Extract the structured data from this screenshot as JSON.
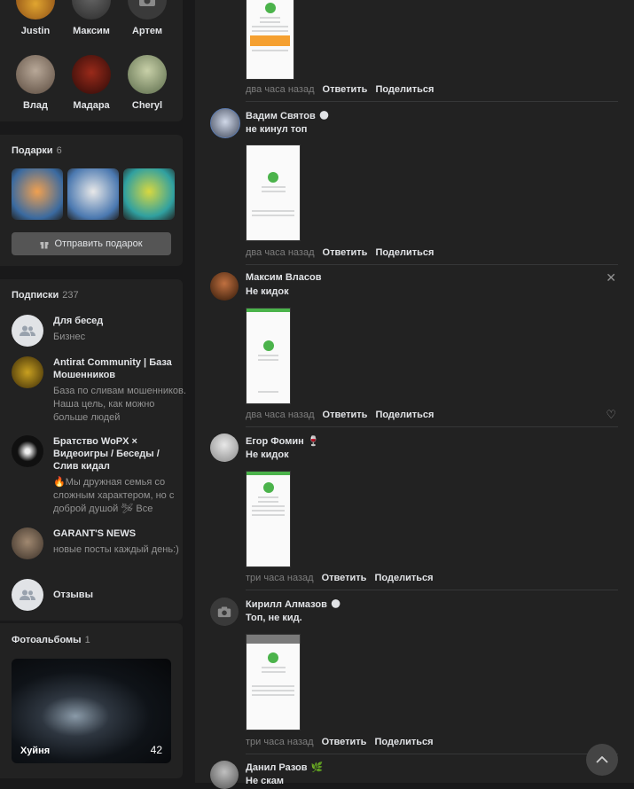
{
  "friends": [
    {
      "name": "Justin"
    },
    {
      "name": "Максим"
    },
    {
      "name": "Артем"
    },
    {
      "name": "Влад"
    },
    {
      "name": "Мадара"
    },
    {
      "name": "Cheryl"
    }
  ],
  "gifts": {
    "title": "Подарки",
    "count": "6",
    "send_label": "Отправить подарок"
  },
  "subscriptions": {
    "title": "Подписки",
    "count": "237",
    "items": [
      {
        "title": "Для бесед",
        "desc": "Бизнес"
      },
      {
        "title": "Antirat Community | База Мошенников",
        "desc": "База по сливам мошенников. Наша цель, как можно больше людей"
      },
      {
        "title": "Братство WoPX × Видеоигры / Беседы / Слив кидал",
        "desc": "🔥Мы дружная семья со сложным характером, но с доброй душой 🛩 Все"
      },
      {
        "title": "GARANT'S NEWS",
        "desc": "новые посты каждый день:)"
      },
      {
        "title": "Отзывы",
        "desc": ""
      }
    ]
  },
  "albums": {
    "title": "Фотоальбомы",
    "count": "1",
    "items": [
      {
        "title": "Хуйня",
        "count": "42"
      }
    ]
  },
  "comments": [
    {
      "author": "",
      "emoji": "",
      "text": "",
      "time": "два часа назад",
      "reply": "Ответить",
      "share": "Поделиться"
    },
    {
      "author": "Вадим Святов",
      "emoji": "🌑",
      "text": "не кинул топ",
      "time": "два часа назад",
      "reply": "Ответить",
      "share": "Поделиться"
    },
    {
      "author": "Максим Власов",
      "emoji": "",
      "text": "Не кидок",
      "time": "два часа назад",
      "reply": "Ответить",
      "share": "Поделиться"
    },
    {
      "author": "Егор Фомин",
      "emoji": "🍷",
      "text": "Не кидок",
      "time": "три часа назад",
      "reply": "Ответить",
      "share": "Поделиться"
    },
    {
      "author": "Кирилл Алмазов",
      "emoji": "🌑",
      "text": "Топ, не кид.",
      "time": "три часа назад",
      "reply": "Ответить",
      "share": "Поделиться"
    },
    {
      "author": "Данил Разов",
      "emoji": "🌿",
      "text": "Не скам",
      "time": "",
      "reply": "",
      "share": ""
    }
  ],
  "icons": {
    "close": "close-icon",
    "like": "heart-icon",
    "scroll_top": "chevron-up-icon",
    "camera": "camera-icon",
    "gift": "gift-icon"
  },
  "colors": {
    "background": "#19191a",
    "card": "#222222",
    "text": "#e1e3e6",
    "muted": "#939393",
    "success": "#4bb34b"
  }
}
